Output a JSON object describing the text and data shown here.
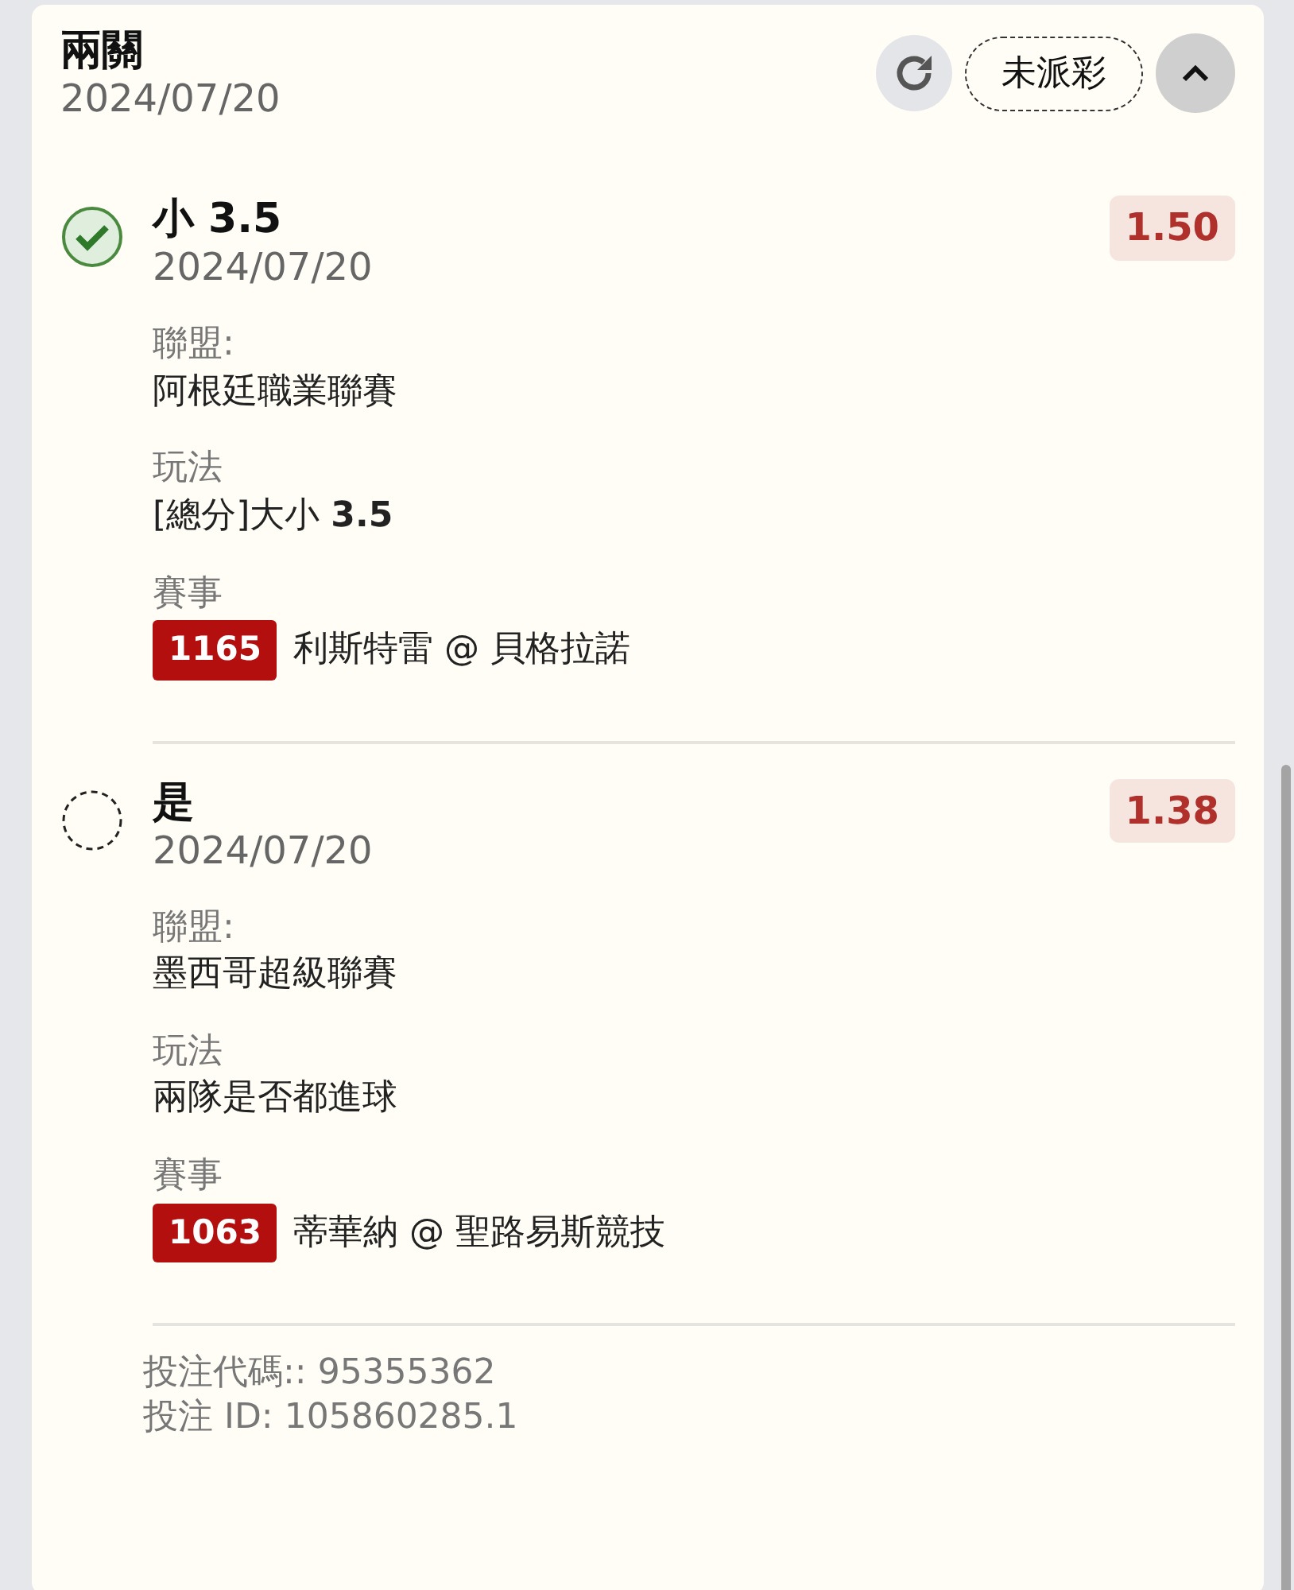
{
  "header": {
    "title": "兩關",
    "date": "2024/07/20",
    "status": "未派彩",
    "expanded": true
  },
  "legs": [
    {
      "selection": "小 3.5",
      "settled": true,
      "date": "2024/07/20",
      "odds": "1.50",
      "league_label": "聯盟:",
      "league": "阿根廷職業聯賽",
      "market_label": "玩法",
      "market": "[總分]大小 **3.5**",
      "event_label": "賽事",
      "event_code": "1165",
      "event": "利斯特雷 @ 貝格拉諾"
    },
    {
      "selection": "是",
      "settled": false,
      "date": "2024/07/20",
      "odds": "1.38",
      "league_label": "聯盟:",
      "league": "墨西哥超級聯賽",
      "market_label": "玩法",
      "market": "兩隊是否都進球",
      "event_label": "賽事",
      "event_code": "1063",
      "event": "蒂華納 @ 聖路易斯競技"
    }
  ],
  "footer": {
    "bet_code": "投注代碼:: 95355362",
    "bet_id": "投注 ID: 105860285.1"
  }
}
